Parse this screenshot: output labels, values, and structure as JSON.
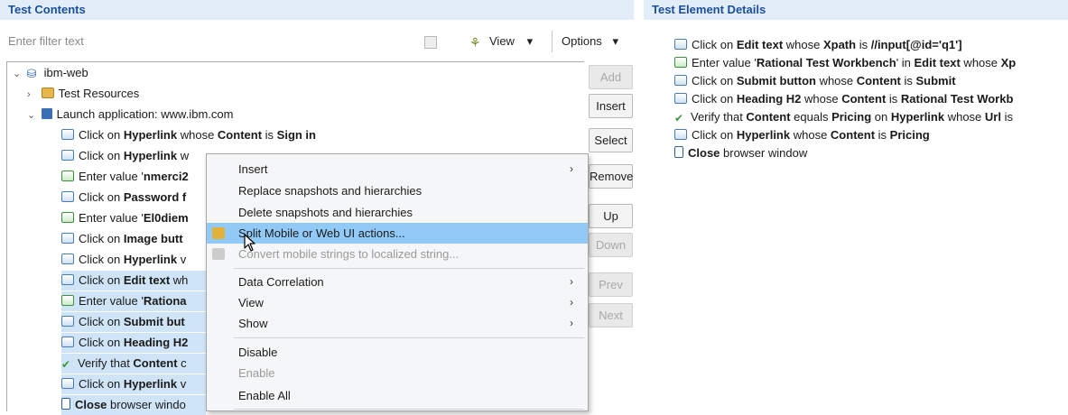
{
  "left_panel": {
    "title": "Test Contents",
    "filter_placeholder": "Enter filter text",
    "view_label": "View",
    "view_arrow": "▾",
    "options_label": "Options",
    "options_arrow": "▾"
  },
  "right_panel": {
    "title": "Test Element Details"
  },
  "tree": {
    "root": "ibm-web",
    "resources": "Test Resources",
    "launch": "Launch application: www.ibm.com",
    "steps": [
      [
        "Click on ",
        "Hyperlink",
        " whose ",
        "Content",
        " is ",
        "Sign in"
      ],
      [
        "Click on ",
        "Hyperlink",
        " w",
        "",
        "",
        ""
      ],
      [
        "Enter value '",
        "nmerci2",
        "",
        "",
        "",
        ""
      ],
      [
        "Click on ",
        "Password f",
        "",
        "",
        "",
        ""
      ],
      [
        "Enter value '",
        "El0diem",
        "",
        "",
        "",
        ""
      ],
      [
        "Click on ",
        "Image butt",
        "",
        "",
        "",
        ""
      ],
      [
        "Click on ",
        "Hyperlink",
        " v",
        "",
        "",
        ""
      ],
      [
        "Click on ",
        "Edit text",
        " wh",
        "",
        "",
        ""
      ],
      [
        "Enter value '",
        "Rationa",
        "",
        "",
        "",
        ""
      ],
      [
        "Click on ",
        "Submit but",
        "",
        "",
        "",
        ""
      ],
      [
        "Click on ",
        "Heading H2",
        "",
        "",
        "",
        ""
      ],
      [
        "Verify that ",
        "Content",
        " c",
        "",
        "",
        ""
      ],
      [
        "Click on ",
        "Hyperlink",
        " v",
        "",
        "",
        ""
      ],
      [
        "",
        "Close",
        " browser windo",
        "",
        "",
        ""
      ]
    ]
  },
  "buttons": {
    "add": "Add",
    "insert": "Insert",
    "select": "Select",
    "remove": "Remove",
    "up": "Up",
    "down": "Down",
    "prev": "Prev",
    "next": "Next"
  },
  "context_menu": {
    "insert": "Insert",
    "replace": "Replace snapshots and hierarchies",
    "delete": "Delete snapshots and hierarchies",
    "split": "Split Mobile or Web UI actions...",
    "convert": "Convert mobile strings to localized string...",
    "data_correlation": "Data Correlation",
    "view": "View",
    "show": "Show",
    "disable": "Disable",
    "enable": "Enable",
    "enable_all": "Enable All",
    "submenu_arrow": "›"
  },
  "details": [
    [
      "Click on ",
      "Edit text",
      " whose ",
      "Xpath",
      " is ",
      "//input[@id='q1']"
    ],
    [
      "Enter value '",
      "Rational Test Workbench",
      "' in ",
      "Edit text",
      " whose ",
      "Xp"
    ],
    [
      "Click on ",
      "Submit button",
      " whose ",
      "Content",
      " is ",
      "Submit"
    ],
    [
      "Click on ",
      "Heading H2",
      " whose ",
      "Content",
      " is ",
      "Rational Test Workb"
    ],
    [
      "Verify that ",
      "Content",
      " equals ",
      "Pricing",
      " on ",
      "Hyperlink",
      " whose ",
      "Url",
      " is"
    ],
    [
      "Click on ",
      "Hyperlink",
      " whose ",
      "Content",
      " is ",
      "Pricing"
    ],
    [
      "",
      "Close",
      " browser window"
    ]
  ],
  "icons": {
    "expand": "⌄",
    "collapse": "›",
    "verify": "✔",
    "project": "⛁",
    "view_icon": "⚘"
  }
}
